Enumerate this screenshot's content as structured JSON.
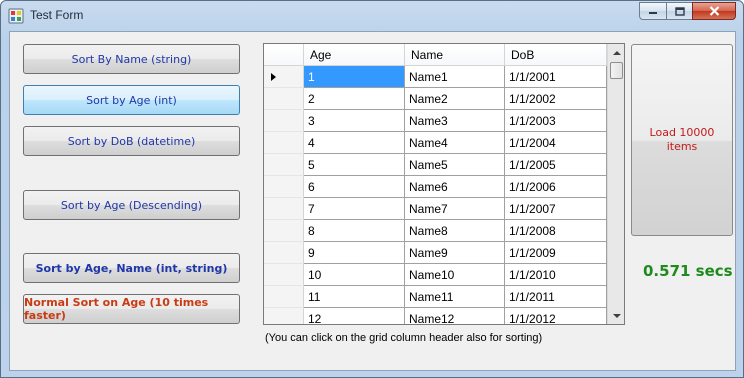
{
  "window": {
    "title": "Test Form",
    "controls": {
      "minimize": "minimize",
      "maximize": "maximize",
      "close": "close"
    }
  },
  "buttons": {
    "sort_name": "Sort By Name (string)",
    "sort_age": "Sort by Age (int)",
    "sort_dob": "Sort by DoB (datetime)",
    "sort_age_desc": "Sort by Age (Descending)",
    "sort_age_name": "Sort by Age, Name (int, string)",
    "normal_sort": "Normal Sort on Age (10 times faster)",
    "load_items": "Load 10000 items"
  },
  "grid": {
    "columns": [
      "Age",
      "Name",
      "DoB"
    ],
    "rows": [
      [
        "1",
        "Name1",
        "1/1/2001"
      ],
      [
        "2",
        "Name2",
        "1/1/2002"
      ],
      [
        "3",
        "Name3",
        "1/1/2003"
      ],
      [
        "4",
        "Name4",
        "1/1/2004"
      ],
      [
        "5",
        "Name5",
        "1/1/2005"
      ],
      [
        "6",
        "Name6",
        "1/1/2006"
      ],
      [
        "7",
        "Name7",
        "1/1/2007"
      ],
      [
        "8",
        "Name8",
        "1/1/2008"
      ],
      [
        "9",
        "Name9",
        "1/1/2009"
      ],
      [
        "10",
        "Name10",
        "1/1/2010"
      ],
      [
        "11",
        "Name11",
        "1/1/2011"
      ],
      [
        "12",
        "Name12",
        "1/1/2012"
      ]
    ]
  },
  "hint": "(You can click on the grid column header also for sorting)",
  "timing": "0.571 secs",
  "colors": {
    "accent": "#2037a8",
    "warning": "#c83c14",
    "timing": "#1e8a1e",
    "selection": "#3399ff"
  }
}
